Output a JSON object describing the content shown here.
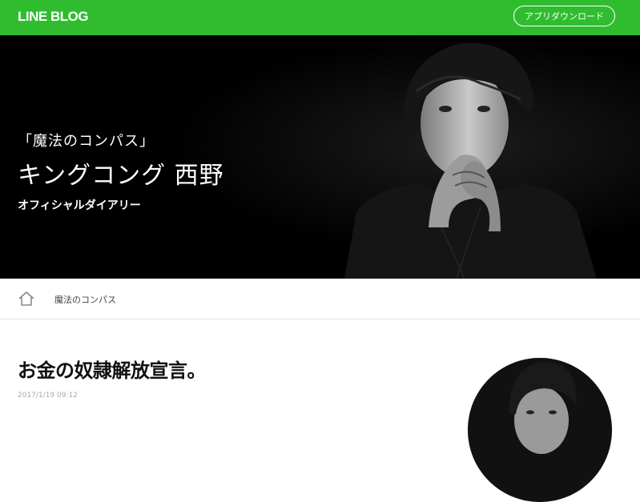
{
  "header": {
    "logo": "LINE BLOG",
    "app_button": "アプリダウンロード"
  },
  "hero": {
    "subtitle": "「魔法のコンパス」",
    "title": "キングコング 西野",
    "tagline": "オフィシャルダイアリー"
  },
  "breadcrumb": {
    "home_icon": "home-icon",
    "item": "魔法のコンパス"
  },
  "post": {
    "title": "お金の奴隷解放宣言。",
    "date": "2017/1/19 09:12"
  },
  "colors": {
    "brand_green": "#2fbd2f",
    "hero_bg": "#000000"
  }
}
